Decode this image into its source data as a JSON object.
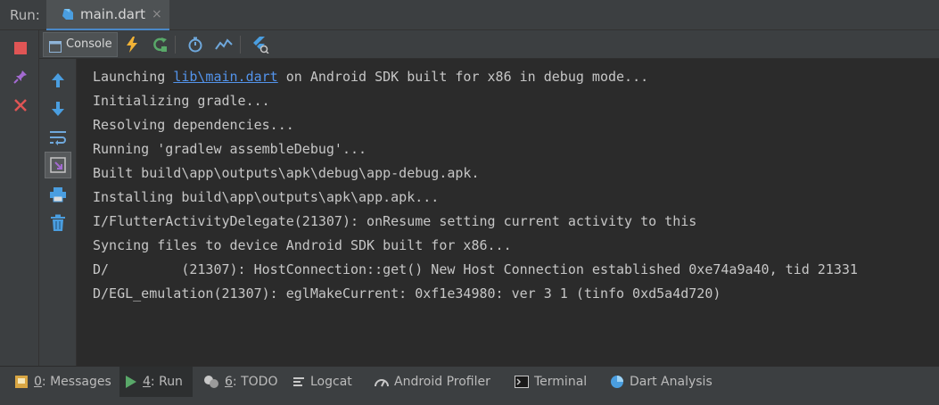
{
  "run_bar": {
    "label": "Run:",
    "tab_title": "main.dart",
    "close_glyph": "×"
  },
  "console_toolbar": {
    "console_tab_label": "Console"
  },
  "console": {
    "lines": [
      {
        "prefix": "Launching ",
        "link": "lib\\main.dart",
        "suffix": " on Android SDK built for x86 in debug mode..."
      },
      {
        "text": "Initializing gradle..."
      },
      {
        "text": "Resolving dependencies..."
      },
      {
        "text": "Running 'gradlew assembleDebug'..."
      },
      {
        "text": "Built build\\app\\outputs\\apk\\debug\\app-debug.apk."
      },
      {
        "text": "Installing build\\app\\outputs\\apk\\app.apk..."
      },
      {
        "text": "I/FlutterActivityDelegate(21307): onResume setting current activity to this"
      },
      {
        "text": "Syncing files to device Android SDK built for x86..."
      },
      {
        "text": "D/         (21307): HostConnection::get() New Host Connection established 0xe74a9a40, tid 21331"
      },
      {
        "text": "D/EGL_emulation(21307): eglMakeCurrent: 0xf1e34980: ver 3 1 (tinfo 0xd5a4d720)"
      }
    ]
  },
  "bottom_bar": {
    "messages": {
      "num": "0",
      "label": ": Messages"
    },
    "run": {
      "num": "4",
      "label": ": Run"
    },
    "todo": {
      "num": "6",
      "label": ": TODO"
    },
    "logcat": "Logcat",
    "profiler": "Android Profiler",
    "terminal": "Terminal",
    "dart_analysis": "Dart Analysis"
  },
  "colors": {
    "background": "#2b2b2b",
    "panel": "#3c3f41",
    "link": "#5394ec",
    "stop": "#e05555",
    "flutter_blue": "#4a9ee0"
  },
  "icons": {
    "stop": "stop-icon",
    "pin": "pin-icon",
    "close": "close-icon",
    "hot_reload": "lightning-icon",
    "hot_restart": "restart-icon",
    "stopwatch": "stopwatch-icon",
    "performance": "chart-icon",
    "inspector": "flutter-inspector-icon",
    "scroll_up": "arrow-up-icon",
    "scroll_down": "arrow-down-icon",
    "soft_wrap": "soft-wrap-icon",
    "scroll_to_end": "scroll-to-end-icon",
    "print": "print-icon",
    "trash": "trash-icon"
  }
}
